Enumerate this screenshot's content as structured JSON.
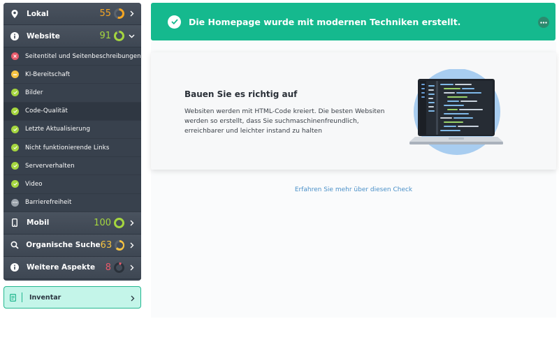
{
  "sidebar": {
    "categories": {
      "lokal": {
        "label": "Lokal",
        "score": "55",
        "color": "#f5a623"
      },
      "website": {
        "label": "Website",
        "score": "91",
        "color": "#a5d63f"
      },
      "mobil": {
        "label": "Mobil",
        "score": "100",
        "color": "#a5d63f"
      },
      "organische": {
        "label": "Organische Suche",
        "score": "63",
        "color": "#f5c242"
      },
      "weitere": {
        "label": "Weitere Aspekte",
        "score": "8",
        "color": "#e85a6a"
      }
    },
    "website_items": [
      {
        "label": "Seitentitel und Seitenbeschreibungen",
        "status": "error"
      },
      {
        "label": "KI-Bereitschaft",
        "status": "warning"
      },
      {
        "label": "Bilder",
        "status": "ok"
      },
      {
        "label": "Code-Qualität",
        "status": "ok"
      },
      {
        "label": "Letzte Aktualisierung",
        "status": "ok"
      },
      {
        "label": "Nicht funktionierende Links",
        "status": "ok"
      },
      {
        "label": "Serververhalten",
        "status": "ok"
      },
      {
        "label": "Video",
        "status": "ok"
      },
      {
        "label": "Barrierefreiheit",
        "status": "pending"
      }
    ],
    "inventar_label": "Inventar"
  },
  "banner": {
    "text": "Die Homepage wurde mit modernen Techniken erstellt."
  },
  "card": {
    "title": "Bauen Sie es richtig auf",
    "description": "Websiten werden mit HTML-Code kreiert. Die besten Websiten werden so erstellt, dass Sie suchmaschinenfreundlich, erreichbarer und leichter instand zu halten"
  },
  "learn_more": "Erfahren Sie mehr über diesen Check",
  "colors": {
    "accent_green": "#15b98e",
    "ok": "#a5d63f",
    "warning": "#f5c242",
    "error": "#e85a6a",
    "pending": "#9aa2ab"
  }
}
